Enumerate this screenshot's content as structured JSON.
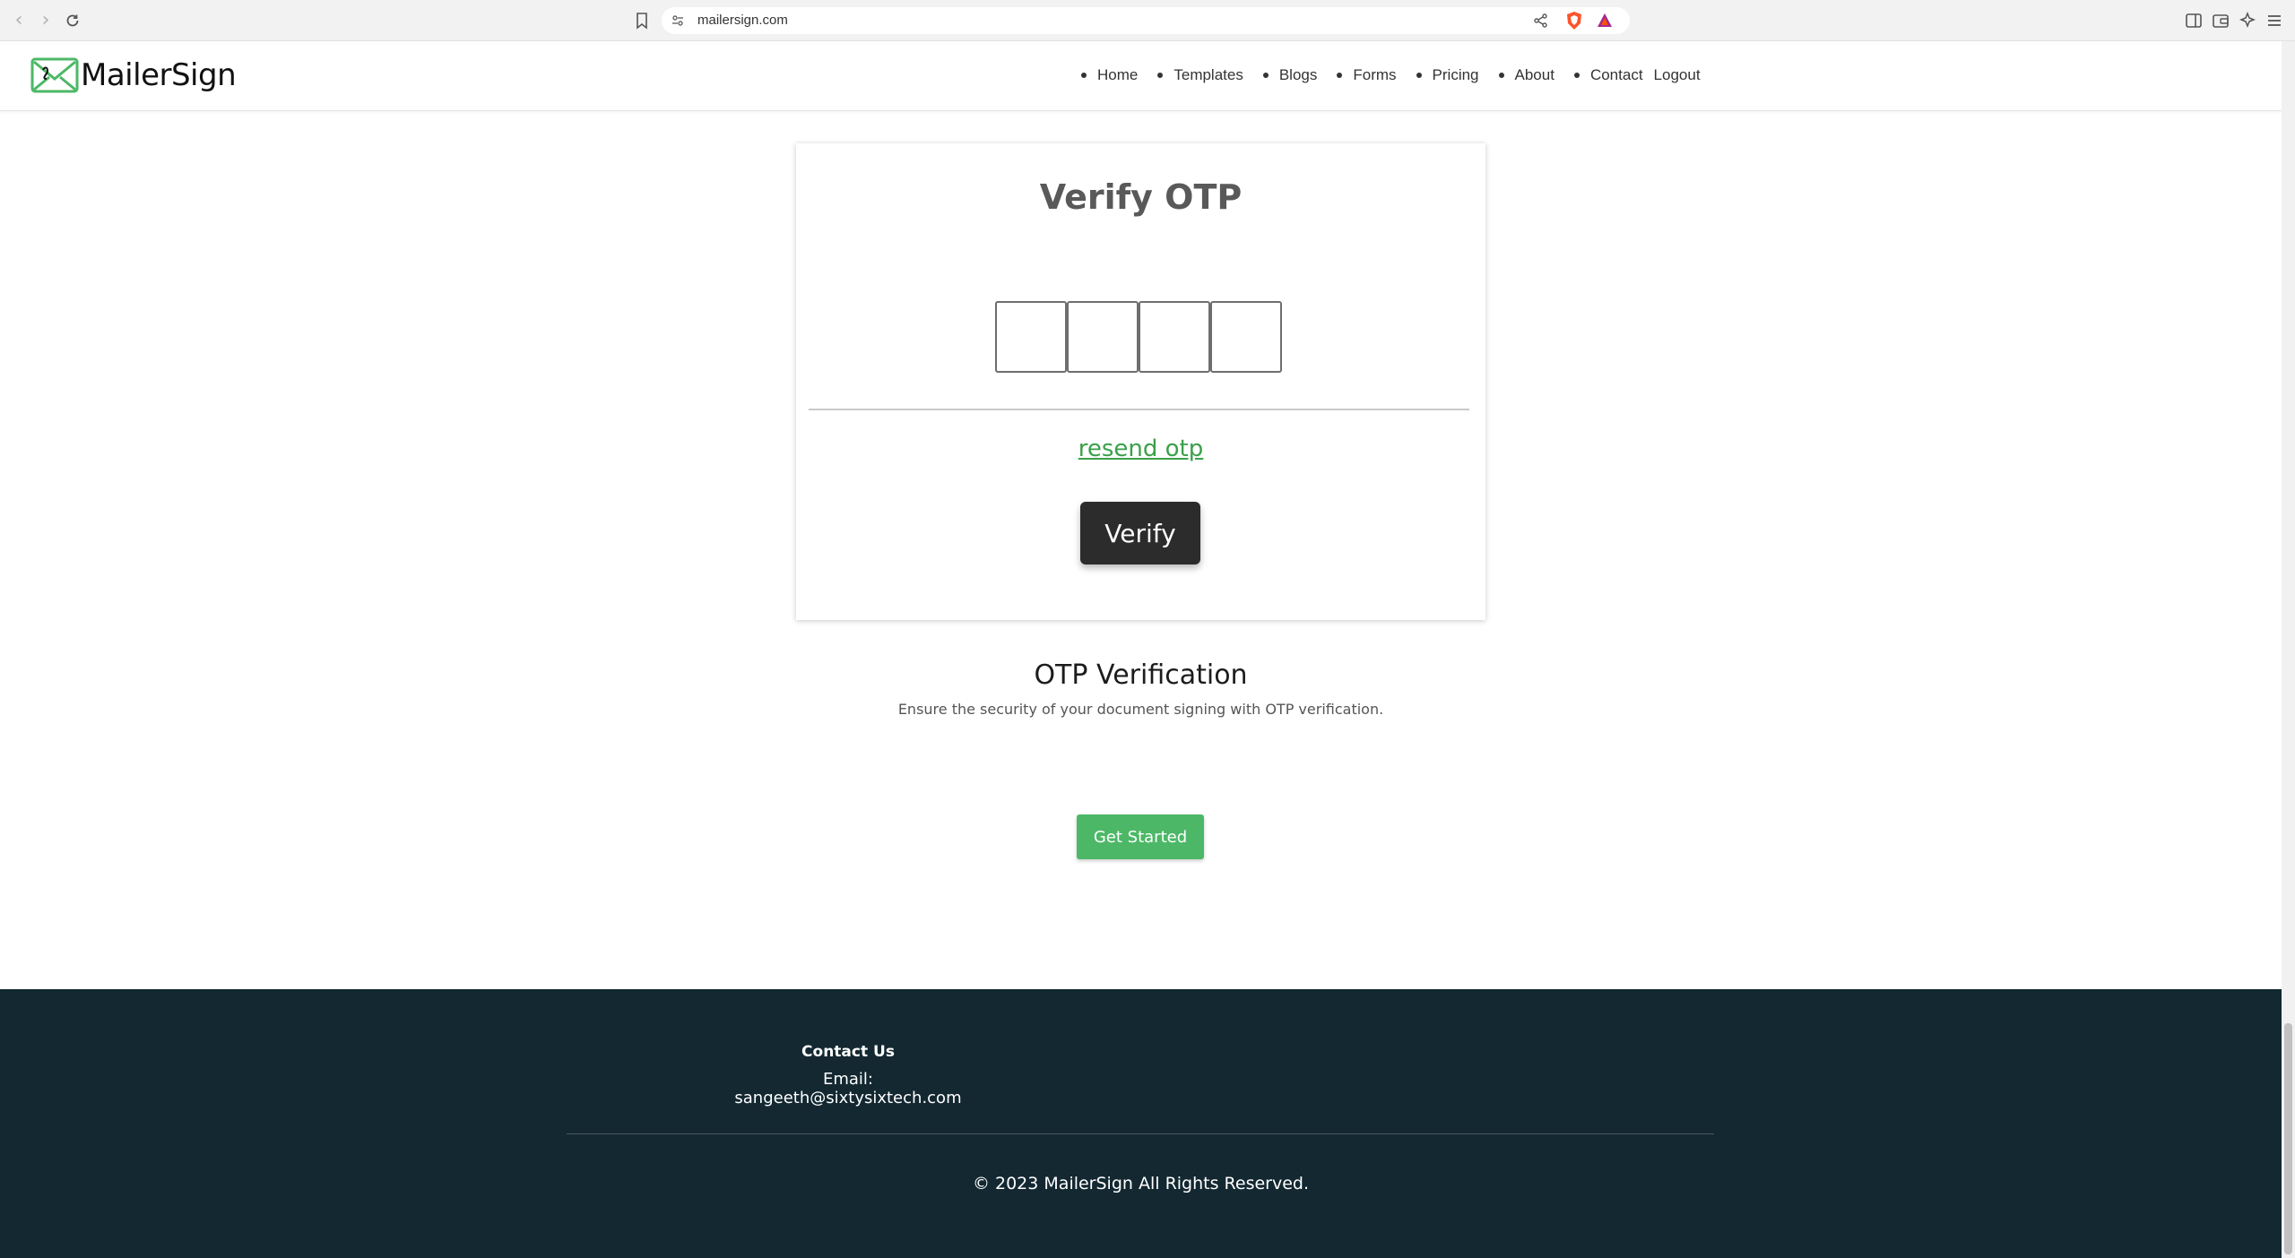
{
  "browser": {
    "url": "mailersign.com"
  },
  "header": {
    "logo_text": "MailerSign",
    "nav": [
      {
        "label": "Home"
      },
      {
        "label": "Templates"
      },
      {
        "label": "Blogs"
      },
      {
        "label": "Forms"
      },
      {
        "label": "Pricing"
      },
      {
        "label": "About"
      },
      {
        "label": "Contact"
      },
      {
        "label": "Logout"
      }
    ]
  },
  "otp_card": {
    "title": "Verify OTP",
    "digits": [
      "",
      "",
      "",
      ""
    ],
    "resend_label": "resend otp",
    "verify_label": "Verify"
  },
  "section": {
    "heading": "OTP Verification",
    "description": "Ensure the security of your document signing with OTP verification.",
    "cta_label": "Get Started"
  },
  "footer": {
    "contact_heading": "Contact Us",
    "email_line": "Email: sangeeth@sixtysixtech.com",
    "copyright": "© 2023 MailerSign All Rights Reserved."
  },
  "colors": {
    "accent_green": "#4cb867",
    "link_green": "#3aa04a",
    "dark_button": "#2c2c2c",
    "footer_bg": "#132831"
  }
}
